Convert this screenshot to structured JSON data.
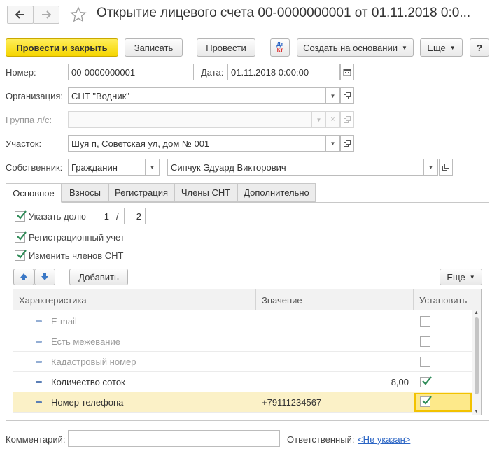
{
  "header": {
    "title": "Открытие лицевого счета 00-0000000001 от 01.11.2018 0:0..."
  },
  "toolbar": {
    "post_close": "Провести и закрыть",
    "save": "Записать",
    "post": "Провести",
    "dtkt_top": "Дт",
    "dtkt_bottom": "Кт",
    "create_based": "Создать на основании",
    "more": "Еще",
    "help": "?"
  },
  "form": {
    "number_label": "Номер:",
    "number_value": "00-0000000001",
    "date_label": "Дата:",
    "date_value": "01.11.2018  0:00:00",
    "org_label": "Организация:",
    "org_value": "СНТ \"Водник\"",
    "group_label": "Группа л/с:",
    "group_value": "",
    "plot_label": "Участок:",
    "plot_value": "Шуя п, Советская ул, дом № 001",
    "owner_label": "Собственник:",
    "owner_type": "Гражданин",
    "owner_name": "Сипчук Эдуард Викторович"
  },
  "tabs": [
    {
      "label": "Основное"
    },
    {
      "label": "Взносы"
    },
    {
      "label": "Регистрация"
    },
    {
      "label": "Члены СНТ"
    },
    {
      "label": "Дополнительно"
    }
  ],
  "main": {
    "share_label": "Указать долю",
    "share_num": "1",
    "share_sep": "/",
    "share_den": "2",
    "reg_label": "Регистрационный учет",
    "members_label": "Изменить членов СНТ",
    "add_label": "Добавить",
    "more_label": "Еще"
  },
  "table": {
    "columns": [
      "Характеристика",
      "Значение",
      "Установить"
    ],
    "rows": [
      {
        "name": "E-mail",
        "value": "",
        "checked": false
      },
      {
        "name": "Есть межевание",
        "value": "",
        "checked": false
      },
      {
        "name": "Кадастровый номер",
        "value": "",
        "checked": false
      },
      {
        "name": "Количество соток",
        "value": "8,00",
        "checked": true
      },
      {
        "name": "Номер телефона",
        "value": "+79111234567",
        "checked": true
      }
    ]
  },
  "footer": {
    "comment_label": "Комментарий:",
    "comment_value": "",
    "responsible_label": "Ответственный:",
    "responsible_value": "<Не указан>"
  },
  "colors": {
    "primary_button": "#f5d500",
    "link": "#2a64c4",
    "selected_row": "#fbf1c7",
    "check": "#2e8b57"
  }
}
